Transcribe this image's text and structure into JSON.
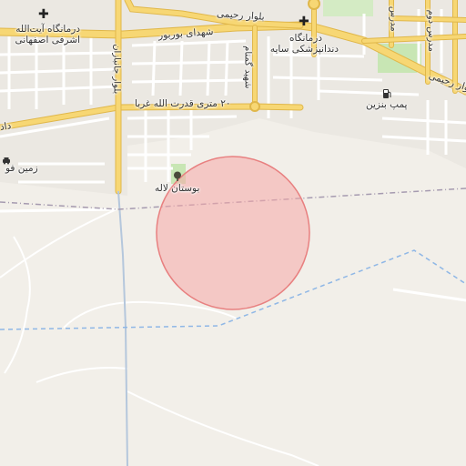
{
  "map": {
    "labels": {
      "clinic_ayatollah_line1": "درمانگاه آیت‌الله",
      "clinic_ayatollah_line2": "اشرفی اصفهانی",
      "clinic_dental_line1": "درمانگاه",
      "clinic_dental_line2": "دندانپزشکی سایه",
      "gas_station": "پمپ بنزین",
      "park": "بوستان لاله",
      "land_partial": "زمین فو",
      "road_shohada": "شهدای بوربور",
      "road_rahimi_1": "بلوار رحیمی",
      "road_rahimi_2": "بلوار رحیمی",
      "road_20_metri": "۲۰ متری قدرت الله غربا",
      "road_left_partial": "داد",
      "road_vertical_1": "بلوار جانبازان",
      "road_vertical_2": "شهید گمنام",
      "road_vertical_3": "مدرس",
      "road_vertical_4": "مدرس دوم"
    },
    "icons": {
      "clinic": "plus-icon",
      "gas": "fuel-pump-icon",
      "park": "tree-icon",
      "land": "car-icon"
    },
    "colors": {
      "background": "#f2efe9",
      "major_road": "#f7d774",
      "major_road_border": "#e0b74a",
      "minor_road": "#ffffff",
      "circle_fill": "#f6a7a7",
      "circle_stroke": "#e88080",
      "boundary": "#a69bb0",
      "water_dashed": "#8fb7e6",
      "park_green": "#c8e6b4"
    }
  }
}
